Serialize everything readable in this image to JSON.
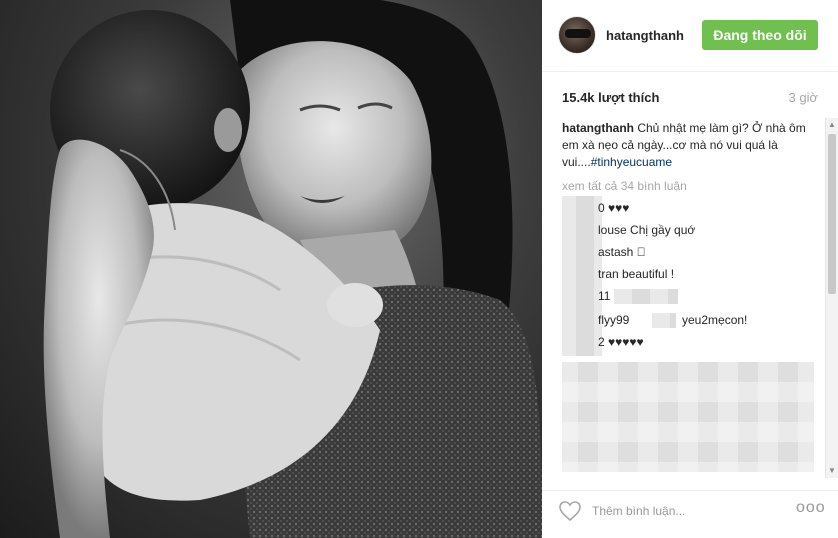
{
  "post": {
    "username": "hatangthanh",
    "follow_label": "Đang theo dõi",
    "likes": "15.4k lượt thích",
    "time_ago": "3 giờ",
    "caption": {
      "username": "hatangthanh",
      "text": " Chủ nhật mẹ làm gì? Ở nhà ôm em xà nẹo cả ngày...cơ mà nó vui quá là vui....",
      "hashtag": "#tinhyeucuame"
    },
    "view_all_comments": "xem tất cả 34 bình luận",
    "comments": [
      {
        "text": "0 ♥♥♥"
      },
      {
        "text": "louse Chị gầy quớ"
      },
      {
        "text": "astash 🏻"
      },
      {
        "text": "tran beautiful !"
      },
      {
        "text": "11"
      },
      {
        "text": "flyy99"
      },
      {
        "text": "yeu2mẹcon!"
      },
      {
        "text": "2 ♥♥♥♥♥"
      }
    ],
    "comment_placeholder": "Thêm bình luận...",
    "more_label": "ooo"
  },
  "icons": {
    "heart": "heart-outline-icon",
    "more": "more-options-icon",
    "scroll_up": "scroll-up-icon",
    "scroll_down": "scroll-down-icon"
  },
  "colors": {
    "follow_bg": "#70c050",
    "text": "#262626",
    "muted": "#a5a7aa",
    "hashtag": "#003569"
  }
}
